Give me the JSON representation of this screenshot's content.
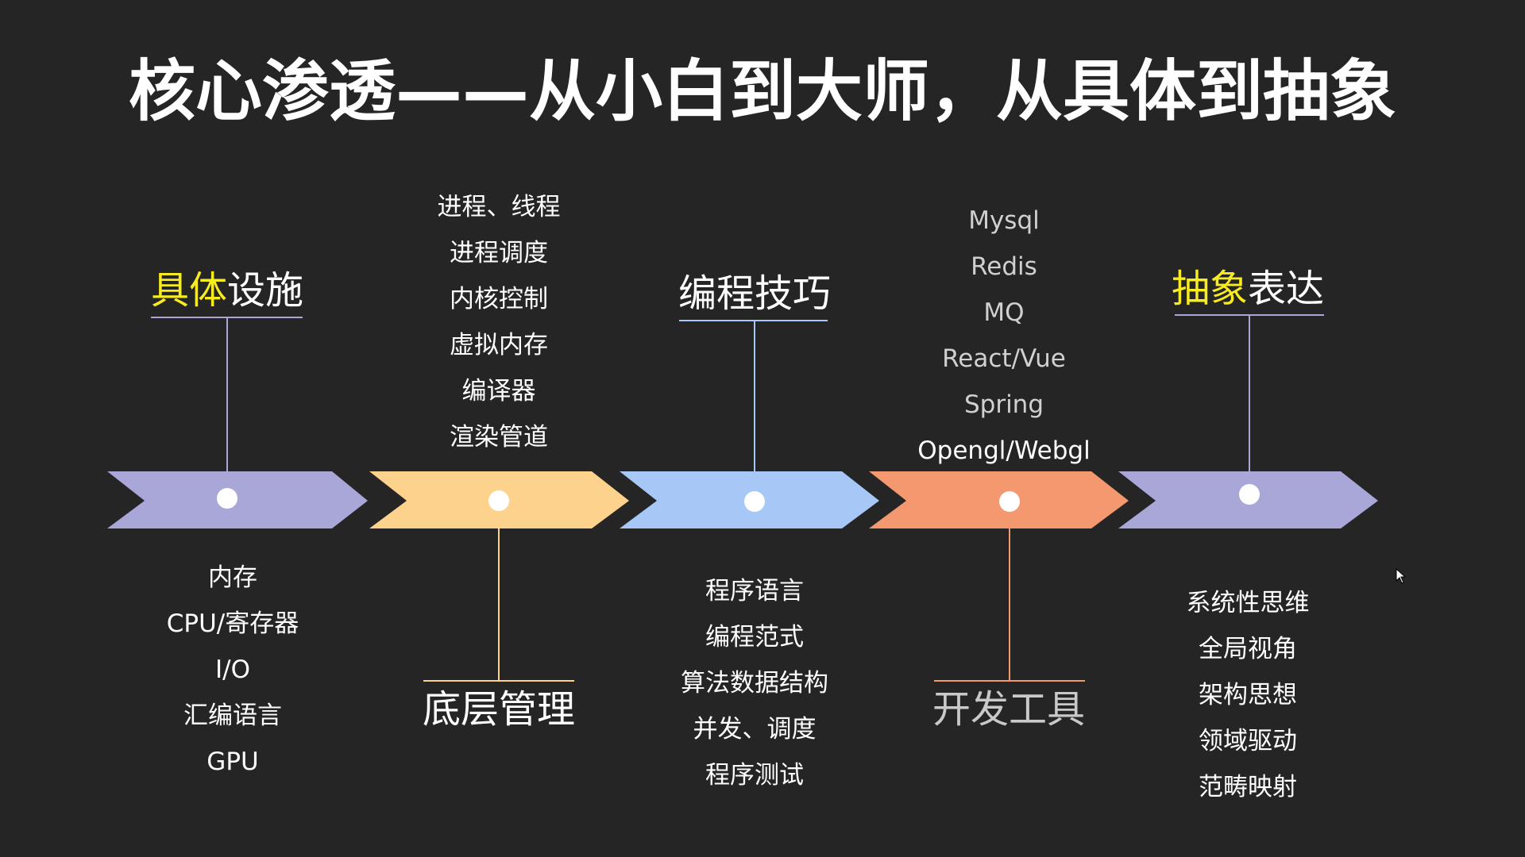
{
  "title": "核心渗透——从小白到大师，从具体到抽象",
  "colors": {
    "background": "#252525",
    "highlight": "#f7ec1f",
    "text": "#ffffff"
  },
  "stages": [
    {
      "title_highlight": "具体",
      "title_rest": "设施",
      "color": "#a9a6d8",
      "items": [
        "内存",
        "CPU/寄存器",
        "I/O",
        "汇编语言",
        "GPU"
      ]
    },
    {
      "title_highlight": "",
      "title_rest": "底层管理",
      "color": "#fcd28c",
      "items": [
        "进程、线程",
        "进程调度",
        "内核控制",
        "虚拟内存",
        "编译器",
        "渲染管道"
      ]
    },
    {
      "title_highlight": "",
      "title_rest": "编程技巧",
      "color": "#a7c8f6",
      "items": [
        "程序语言",
        "编程范式",
        "算法数据结构",
        "并发、调度",
        "程序测试"
      ]
    },
    {
      "title_highlight": "",
      "title_rest": "开发工具",
      "color": "#f4986f",
      "items": [
        "Mysql",
        "Redis",
        "MQ",
        "React/Vue",
        "Spring",
        "Opengl/Webgl"
      ]
    },
    {
      "title_highlight": "抽象",
      "title_rest": "表达",
      "color": "#a9a6d8",
      "items": [
        "系统性思维",
        "全局视角",
        "架构思想",
        "领域驱动",
        "范畴映射"
      ]
    }
  ]
}
